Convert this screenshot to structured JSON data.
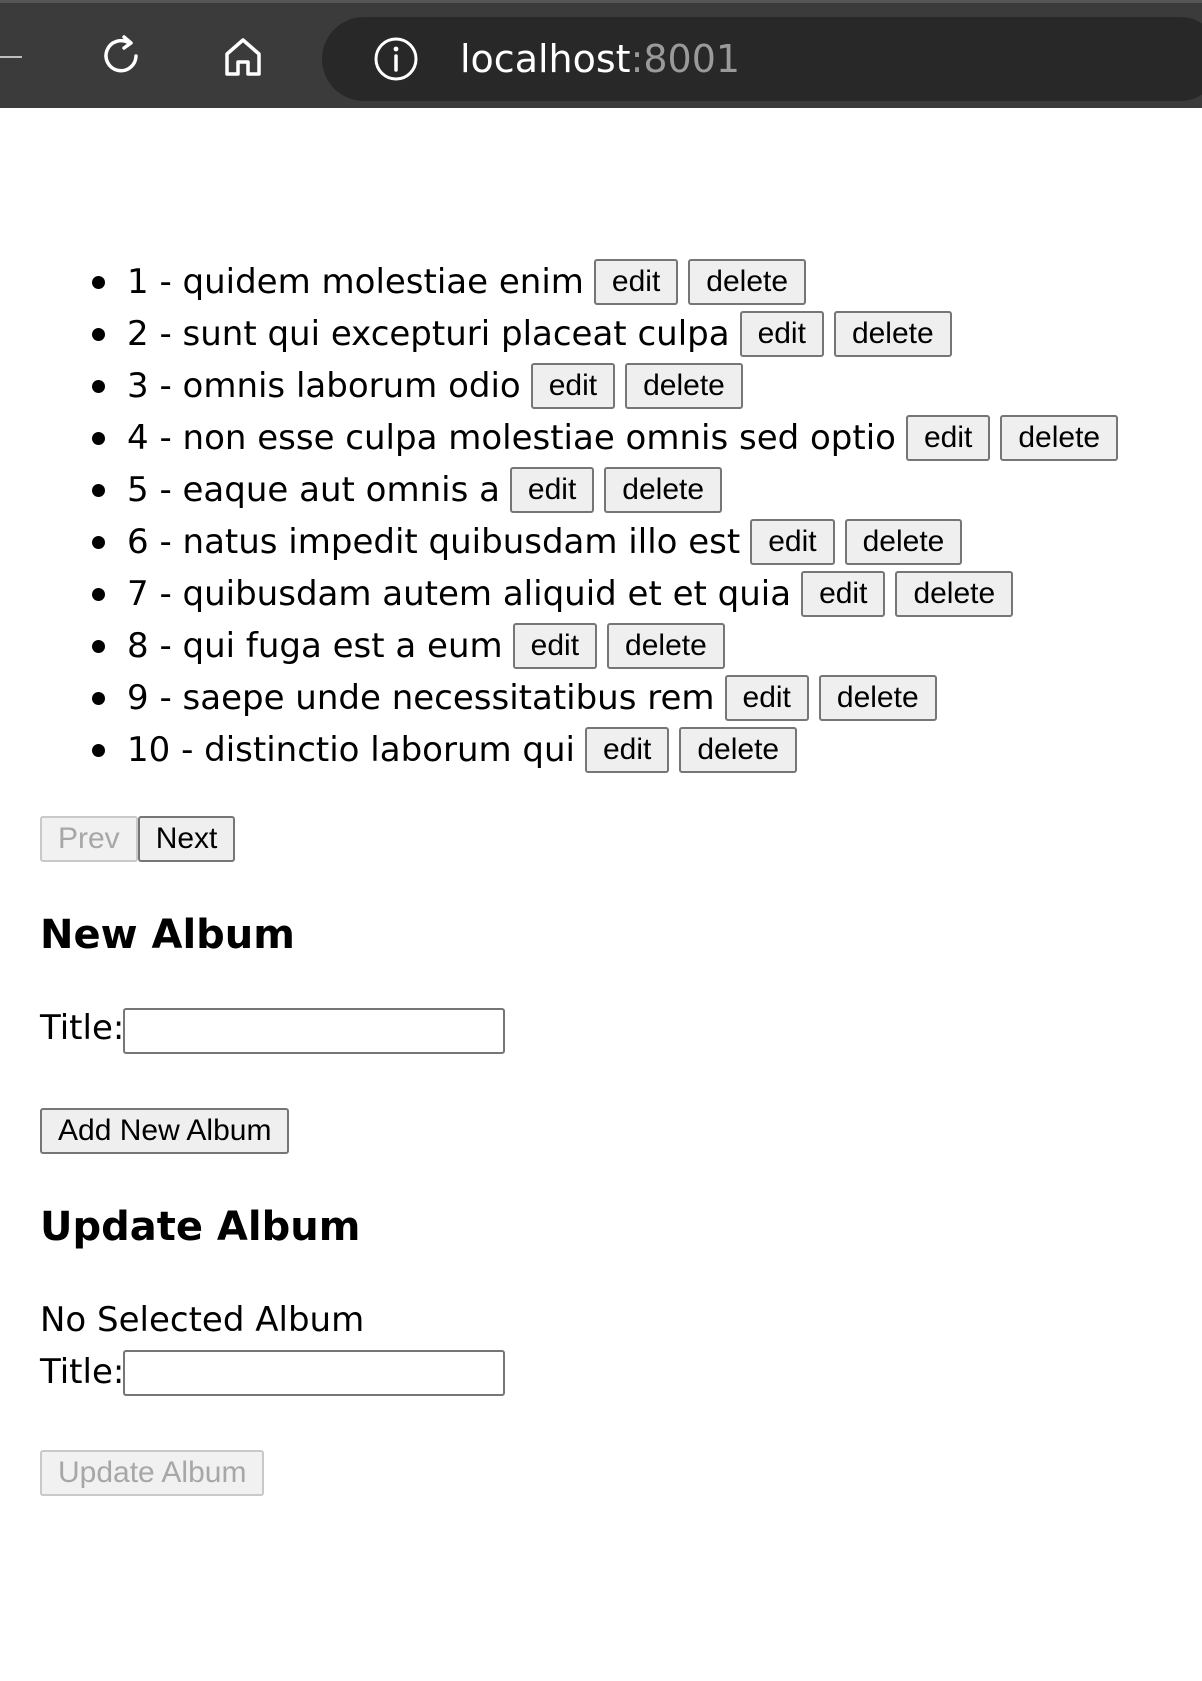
{
  "browser": {
    "url_host": "localhost",
    "url_port": ":8001",
    "icons": [
      "reload-icon",
      "home-icon",
      "info-icon"
    ]
  },
  "albums": [
    {
      "label": "1 - quidem molestiae enim",
      "edit": "edit",
      "delete": "delete"
    },
    {
      "label": "2 - sunt qui excepturi placeat culpa",
      "edit": "edit",
      "delete": "delete"
    },
    {
      "label": "3 - omnis laborum odio",
      "edit": "edit",
      "delete": "delete"
    },
    {
      "label": "4 - non esse culpa molestiae omnis sed optio",
      "edit": "edit",
      "delete": "delete"
    },
    {
      "label": "5 - eaque aut omnis a",
      "edit": "edit",
      "delete": "delete"
    },
    {
      "label": "6 - natus impedit quibusdam illo est",
      "edit": "edit",
      "delete": "delete"
    },
    {
      "label": "7 - quibusdam autem aliquid et et quia",
      "edit": "edit",
      "delete": "delete"
    },
    {
      "label": "8 - qui fuga est a eum",
      "edit": "edit",
      "delete": "delete"
    },
    {
      "label": "9 - saepe unde necessitatibus rem",
      "edit": "edit",
      "delete": "delete"
    },
    {
      "label": "10 - distinctio laborum qui",
      "edit": "edit",
      "delete": "delete"
    }
  ],
  "pager": {
    "prev_label": "Prev",
    "next_label": "Next"
  },
  "new_album": {
    "heading": "New Album",
    "title_label": "Title:",
    "title_value": "",
    "submit_label": "Add New Album"
  },
  "update_album": {
    "heading": "Update Album",
    "status_text": "No Selected Album",
    "title_label": "Title:",
    "title_value": "",
    "submit_label": "Update Album"
  }
}
